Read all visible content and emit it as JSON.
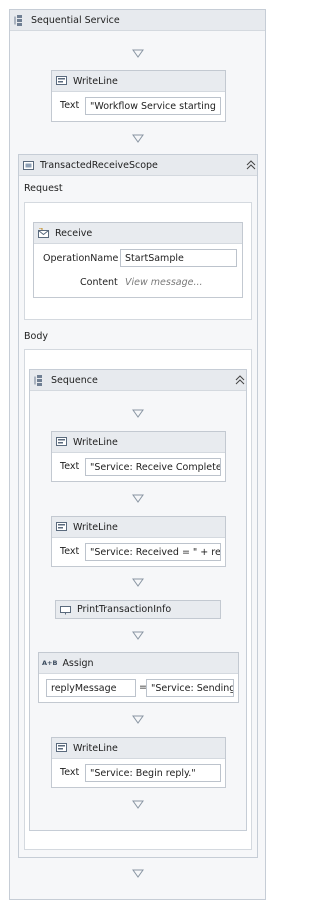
{
  "sequential_service": {
    "title": "Sequential Service"
  },
  "writeline1": {
    "title": "WriteLine",
    "text_label": "Text",
    "text_value": "\"Workflow Service starting ...\""
  },
  "transacted_scope": {
    "title": "TransactedReceiveScope",
    "request_label": "Request",
    "body_label": "Body"
  },
  "receive": {
    "title": "Receive",
    "operation_label": "OperationName",
    "operation_value": "StartSample",
    "content_label": "Content",
    "content_value": "View message..."
  },
  "sequence": {
    "title": "Sequence"
  },
  "writeline2": {
    "title": "WriteLine",
    "text_label": "Text",
    "text_value": "\"Service: Receive Completed\""
  },
  "writeline3": {
    "title": "WriteLine",
    "text_label": "Text",
    "text_value": "\"Service: Received = \" + reque"
  },
  "print_tx": {
    "title": "PrintTransactionInfo"
  },
  "assign": {
    "title": "Assign",
    "icon_text": "A+B",
    "to_value": "replyMessage",
    "equals": "=",
    "value": "\"Service: Sending re"
  },
  "writeline4": {
    "title": "WriteLine",
    "text_label": "Text",
    "text_value": "\"Service: Begin reply.\""
  },
  "colors": {
    "panel_border": "#c6cdd6",
    "header_bg": "#e7eaee",
    "arrow": "#8a96a3"
  }
}
